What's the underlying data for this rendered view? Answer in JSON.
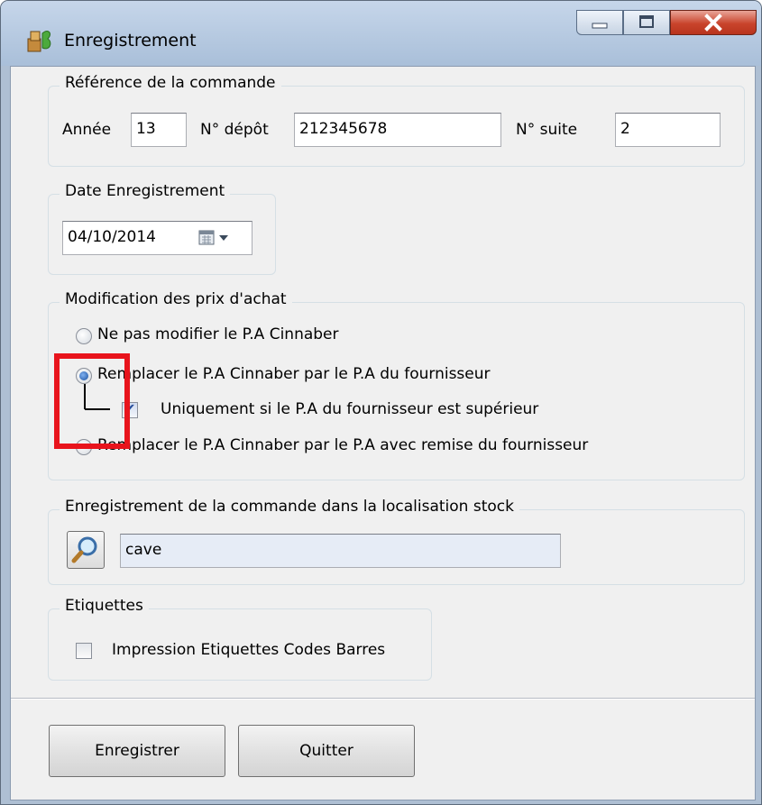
{
  "window": {
    "title": "Enregistrement"
  },
  "reference": {
    "legend": "Référence de la commande",
    "annee_label": "Année",
    "annee_value": "13",
    "depot_label": "N° dépôt",
    "depot_value": "212345678",
    "suite_label": "N° suite",
    "suite_value": "2"
  },
  "date": {
    "legend": "Date Enregistrement",
    "value": "04/10/2014"
  },
  "prix": {
    "legend": "Modification des prix d'achat",
    "options": [
      {
        "label": "Ne pas modifier le P.A Cinnaber",
        "checked": false
      },
      {
        "label": "Remplacer le P.A Cinnaber par le P.A du fournisseur",
        "checked": true
      },
      {
        "label": "Remplacer le P.A Cinnaber par le P.A avec remise du fournisseur",
        "checked": false
      }
    ],
    "sub_checkbox_label": "Uniquement si le P.A du fournisseur est supérieur",
    "sub_checkbox_checked": true
  },
  "stock": {
    "legend": "Enregistrement de la commande dans la localisation stock",
    "value": "cave"
  },
  "etiquettes": {
    "legend": "Etiquettes",
    "checkbox_label": "Impression Etiquettes Codes Barres",
    "checked": false
  },
  "buttons": {
    "save": "Enregistrer",
    "quit": "Quitter"
  },
  "colors": {
    "highlight": "#e8141c",
    "client_bg": "#f0f0f0",
    "frame": "#aebfd3"
  }
}
